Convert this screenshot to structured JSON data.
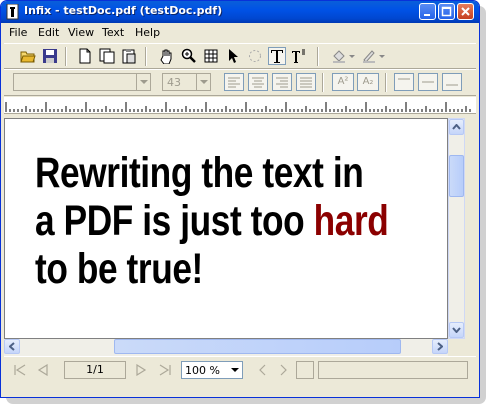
{
  "window": {
    "title": "Infix - testDoc.pdf (testDoc.pdf)",
    "app_icon": "infix-app-icon",
    "controls": [
      "minimize-icon",
      "maximize-icon",
      "close-icon"
    ]
  },
  "menu": {
    "items": [
      {
        "label": "File"
      },
      {
        "label": "Edit"
      },
      {
        "label": "View"
      },
      {
        "label": "Text"
      },
      {
        "label": "Help"
      }
    ]
  },
  "toolbar": {
    "tools": [
      "open-folder-icon",
      "save-icon",
      "page-icon",
      "copy-page-icon",
      "paste-page-icon",
      "hand-tool-icon",
      "zoom-tool-icon",
      "grid-tool-icon",
      "select-arrow-icon",
      "lasso-icon",
      "text-tool-icon",
      "text-paragraph-tool-icon",
      "fill-color-icon",
      "line-color-icon"
    ]
  },
  "format_bar": {
    "font_value": "",
    "size_value": "43",
    "superscript_label": "A²",
    "subscript_label": "A₂"
  },
  "document": {
    "line1": "Rewriting the text in",
    "line2_prefix": "a PDF is just too ",
    "line2_highlight": "hard",
    "line3": "to be true!",
    "highlight_color": "#8b0000"
  },
  "status": {
    "page_display": "1/1",
    "zoom_value": "100 %"
  }
}
